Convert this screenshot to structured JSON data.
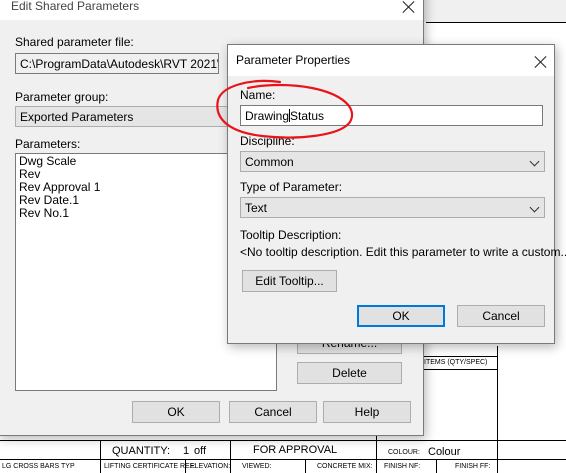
{
  "shared_dialog": {
    "title": "Edit Shared Parameters",
    "file_label": "Shared parameter file:",
    "file_path": "C:\\ProgramData\\Autodesk\\RVT 2021\\Libr",
    "group_label": "Parameter group:",
    "group_value": "Exported Parameters",
    "parameters_label": "Parameters:",
    "parameters": [
      "Dwg Scale",
      "Rev",
      "Rev Approval 1",
      "Rev Date.1",
      "Rev No.1"
    ],
    "rename_label": "Rename...",
    "delete_label": "Delete",
    "ok_label": "OK",
    "cancel_label": "Cancel",
    "help_label": "Help"
  },
  "props_dialog": {
    "title": "Parameter Properties",
    "name_label": "Name:",
    "name_value_before_caret": "Drawing",
    "name_value_after_caret": "Status",
    "discipline_label": "Discipline:",
    "discipline_value": "Common",
    "type_label": "Type of Parameter:",
    "type_value": "Text",
    "tooltip_label": "Tooltip Description:",
    "tooltip_text": "<No tooltip description. Edit this parameter to write a custom...",
    "edit_tooltip_label": "Edit Tooltip...",
    "ok_label": "OK",
    "cancel_label": "Cancel"
  },
  "drawing_sheet": {
    "quantity_label": "QUANTITY:",
    "quantity_value": "1",
    "quantity_unit": "off",
    "approval": "FOR APPROVAL",
    "colour_label": "COLOUR:",
    "colour_value": "Colour",
    "items_label": "ITEMS (QTY/SPEC)",
    "cross_bars": "LG CROSS BARS TYP",
    "lifting_cert": "LIFTING CERTIFICATE REF:",
    "elevation": "ELEVATION:",
    "viewed": "VIEWED:",
    "concrete_mix": "CONCRETE MIX:",
    "finish_nf": "FINISH NF:",
    "finish_ff": "FINISH FF:"
  },
  "annotation_color": "#e8141c"
}
